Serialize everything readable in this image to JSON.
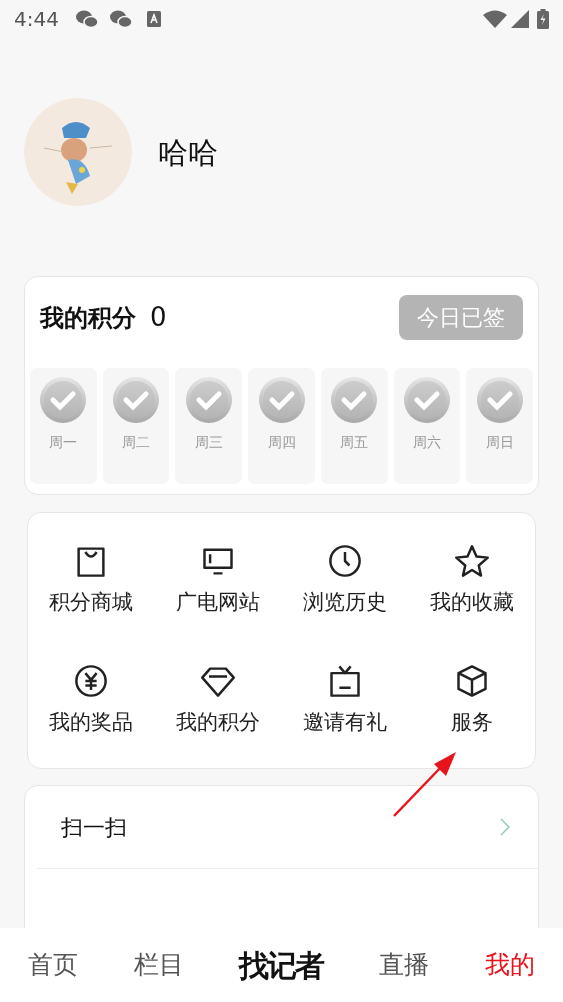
{
  "status_bar": {
    "time": "4:44"
  },
  "profile": {
    "name": "哈哈"
  },
  "points": {
    "title": "我的积分",
    "value": "0",
    "sign_button": {
      "label": "今日已签",
      "disabled": true
    },
    "days": [
      {
        "label": "周一"
      },
      {
        "label": "周二"
      },
      {
        "label": "周三"
      },
      {
        "label": "周四"
      },
      {
        "label": "周五"
      },
      {
        "label": "周六"
      },
      {
        "label": "周日"
      }
    ]
  },
  "features": [
    {
      "label": "积分商城"
    },
    {
      "label": "广电网站"
    },
    {
      "label": "浏览历史"
    },
    {
      "label": "我的收藏"
    },
    {
      "label": "我的奖品"
    },
    {
      "label": "我的积分"
    },
    {
      "label": "邀请有礼"
    },
    {
      "label": "服务"
    }
  ],
  "menu": [
    {
      "label": "扫一扫"
    }
  ],
  "bottom_nav": [
    {
      "label": "首页",
      "kind": "text",
      "selected": false
    },
    {
      "label": "栏目",
      "kind": "text",
      "selected": false
    },
    {
      "label": "找记者",
      "kind": "logo",
      "selected": false
    },
    {
      "label": "直播",
      "kind": "text",
      "selected": false
    },
    {
      "label": "我的",
      "kind": "text",
      "selected": true
    }
  ]
}
